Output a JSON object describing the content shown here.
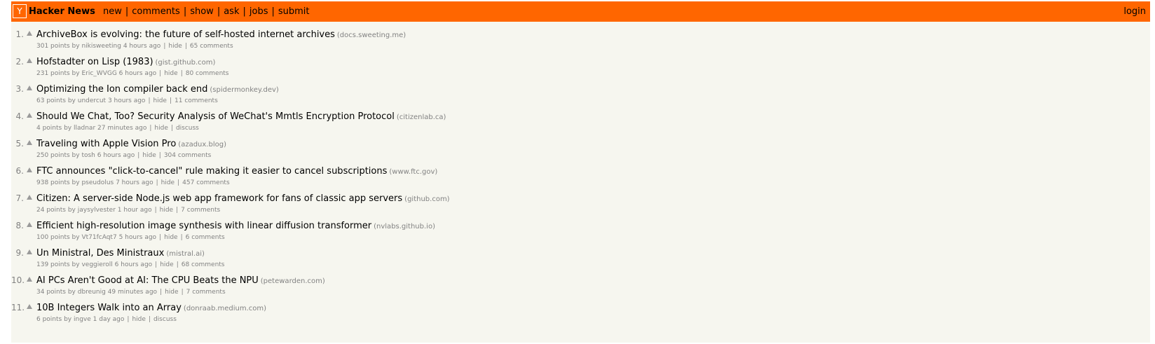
{
  "header": {
    "logo_letter": "Y",
    "site_name": "Hacker News",
    "nav": [
      "new",
      "comments",
      "show",
      "ask",
      "jobs",
      "submit"
    ],
    "login": "login",
    "accent_color": "#ff6600"
  },
  "stories": [
    {
      "rank": "1.",
      "title": "ArchiveBox is evolving: the future of self-hosted internet archives",
      "site": "(docs.sweeting.me)",
      "points": "301 points",
      "user": "nikisweeting",
      "age": "4 hours ago",
      "hide": "hide",
      "comments": "65 comments"
    },
    {
      "rank": "2.",
      "title": "Hofstadter on Lisp (1983)",
      "site": "(gist.github.com)",
      "points": "231 points",
      "user": "Eric_WVGG",
      "age": "6 hours ago",
      "hide": "hide",
      "comments": "80 comments"
    },
    {
      "rank": "3.",
      "title": "Optimizing the Ion compiler back end",
      "site": "(spidermonkey.dev)",
      "points": "63 points",
      "user": "undercut",
      "age": "3 hours ago",
      "hide": "hide",
      "comments": "11 comments"
    },
    {
      "rank": "4.",
      "title": "Should We Chat, Too? Security Analysis of WeChat's Mmtls Encryption Protocol",
      "site": "(citizenlab.ca)",
      "points": "4 points",
      "user": "lladnar",
      "age": "27 minutes ago",
      "hide": "hide",
      "comments": "discuss"
    },
    {
      "rank": "5.",
      "title": "Traveling with Apple Vision Pro",
      "site": "(azadux.blog)",
      "points": "250 points",
      "user": "tosh",
      "age": "6 hours ago",
      "hide": "hide",
      "comments": "304 comments"
    },
    {
      "rank": "6.",
      "title": "FTC announces \"click-to-cancel\" rule making it easier to cancel subscriptions",
      "site": "(www.ftc.gov)",
      "points": "938 points",
      "user": "pseudolus",
      "age": "7 hours ago",
      "hide": "hide",
      "comments": "457 comments"
    },
    {
      "rank": "7.",
      "title": "Citizen: A server-side Node.js web app framework for fans of classic app servers",
      "site": "(github.com)",
      "points": "24 points",
      "user": "jaysylvester",
      "age": "1 hour ago",
      "hide": "hide",
      "comments": "7 comments"
    },
    {
      "rank": "8.",
      "title": "Efficient high-resolution image synthesis with linear diffusion transformer",
      "site": "(nvlabs.github.io)",
      "points": "100 points",
      "user": "Vt71fcAqt7",
      "age": "5 hours ago",
      "hide": "hide",
      "comments": "6 comments"
    },
    {
      "rank": "9.",
      "title": "Un Ministral, Des Ministraux",
      "site": "(mistral.ai)",
      "points": "139 points",
      "user": "veggieroll",
      "age": "6 hours ago",
      "hide": "hide",
      "comments": "68 comments"
    },
    {
      "rank": "10.",
      "title": "AI PCs Aren't Good at AI: The CPU Beats the NPU",
      "site": "(petewarden.com)",
      "points": "34 points",
      "user": "dbreunig",
      "age": "49 minutes ago",
      "hide": "hide",
      "comments": "7 comments"
    },
    {
      "rank": "11.",
      "title": "10B Integers Walk into an Array",
      "site": "(donraab.medium.com)",
      "points": "6 points",
      "user": "ingve",
      "age": "1 day ago",
      "hide": "hide",
      "comments": "discuss"
    }
  ]
}
